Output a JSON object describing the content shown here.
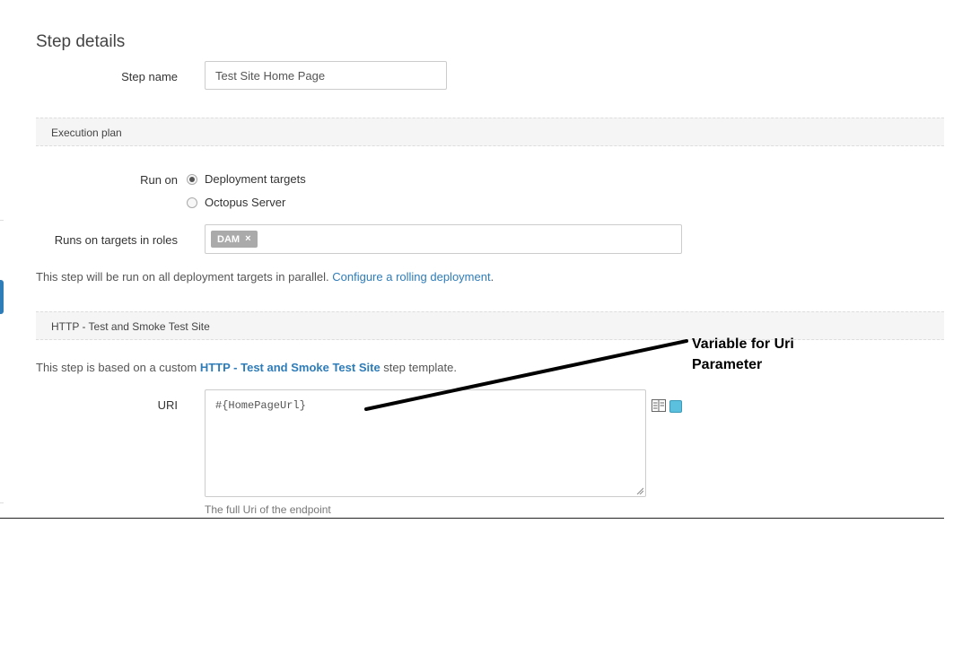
{
  "step_details": {
    "title": "Step details",
    "step_name_label": "Step name",
    "step_name_value": "Test Site Home Page"
  },
  "execution_plan": {
    "section_title": "Execution plan",
    "run_on_label": "Run on",
    "run_on_options": [
      {
        "label": "Deployment targets",
        "checked": true
      },
      {
        "label": "Octopus Server",
        "checked": false
      }
    ],
    "roles_label": "Runs on targets in roles",
    "roles": [
      {
        "label": "DAM",
        "remove_glyph": "×"
      }
    ],
    "parallel_text": "This step will be run on all deployment targets in parallel.",
    "rolling_link": "Configure a rolling deployment",
    "rolling_suffix": "."
  },
  "template_section": {
    "section_title": "HTTP - Test and Smoke Test Site",
    "based_prefix": "This step is based on a custom",
    "template_link_part1": "HTTP",
    "template_link_sep": " - ",
    "template_link_part2": "Test and Smoke Test Site",
    "based_suffix": "step template.",
    "uri_label": "URI",
    "uri_value": "#{HomePageUrl}",
    "uri_hint": "The full Uri of the endpoint"
  },
  "annotation": {
    "line1": "Variable for Uri",
    "line2": "Parameter"
  },
  "icons": {
    "variable_picker": "variable-list-icon",
    "expand": "square-toggle-icon"
  },
  "colors": {
    "link": "#2e7cb8",
    "tag_bg": "#aaaaaa",
    "accent_square": "#5bc0de"
  }
}
